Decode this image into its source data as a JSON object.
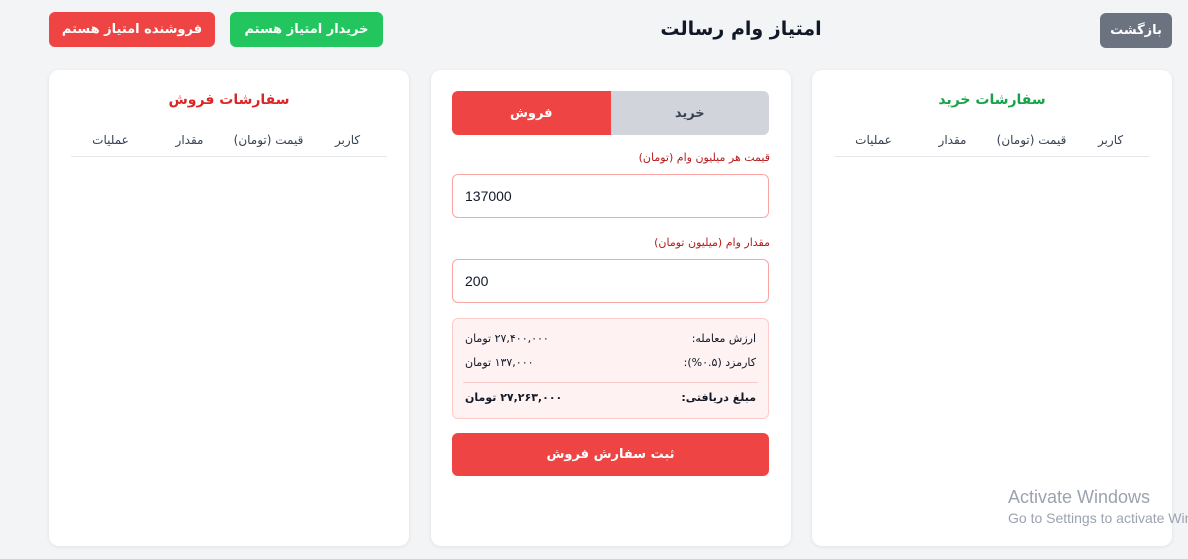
{
  "header": {
    "title": "امتیاز وام رسالت",
    "back_label": "بازگشت",
    "buyer_label": "خریدار امتیاز هستم",
    "seller_label": "فروشنده امتیاز هستم"
  },
  "sell_orders": {
    "title": "سفارشات فروش",
    "columns": [
      "کاربر",
      "قیمت (تومان)",
      "مقدار",
      "عملیات"
    ]
  },
  "buy_orders": {
    "title": "سفارشات خرید",
    "columns": [
      "کاربر",
      "قیمت (تومان)",
      "مقدار",
      "عملیات"
    ]
  },
  "form": {
    "tabs": {
      "buy": "خرید",
      "sell": "فروش",
      "active": "sell"
    },
    "price_label": "قیمت هر میلیون وام (تومان)",
    "price_value": "137000",
    "amount_label": "مقدار وام (میلیون تومان)",
    "amount_value": "200",
    "summary": {
      "value_label": "ارزش معامله:",
      "value": "۲۷,۴۰۰,۰۰۰ تومان",
      "fee_label": "کارمزد (۰.۵%):",
      "fee": "۱۳۷,۰۰۰ تومان",
      "net_label": "مبلغ دریافتی:",
      "net": "۲۷,۲۶۳,۰۰۰ تومان"
    },
    "submit_label": "ثبت سفارش فروش"
  },
  "watermark": {
    "line1": "Activate Windows",
    "line2": "Go to Settings to activate Windows."
  },
  "colors": {
    "accent_red": "#ef4444",
    "accent_green": "#22c55e",
    "back_gray": "#6b7280"
  }
}
